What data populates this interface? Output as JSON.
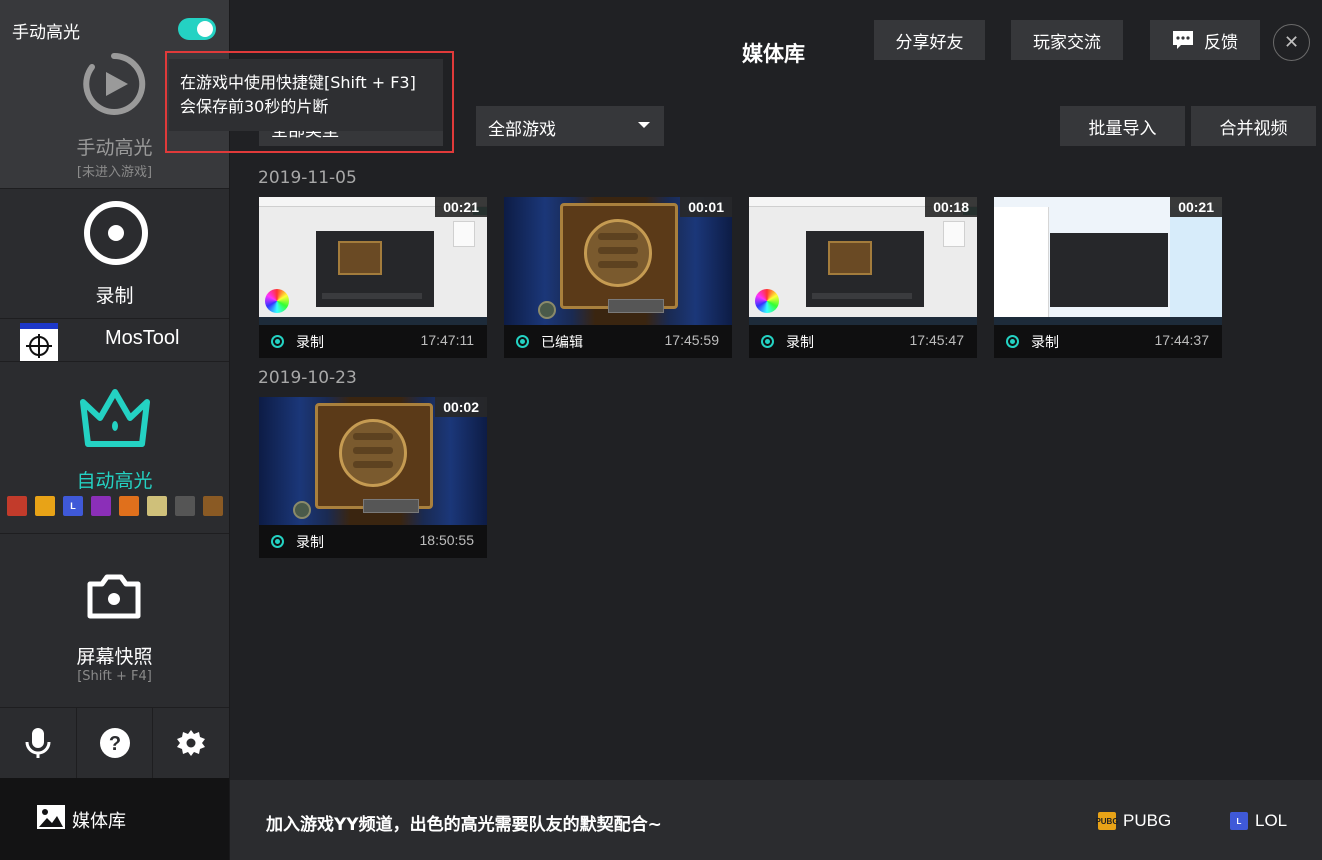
{
  "sidebar": {
    "manual_toggle_label": "手动高光",
    "manual_toggle_on": true,
    "manual_title": "手动高光",
    "manual_sub": "[未进入游戏]",
    "record_label": "录制",
    "mostool_label": "MosTool",
    "auto_label": "自动高光",
    "auto_games": [
      {
        "name": "dota2-icon",
        "text": "",
        "color": "#c23b2b"
      },
      {
        "name": "pubg-icon",
        "text": "PUBG",
        "color": "#e8a317"
      },
      {
        "name": "lol-icon",
        "text": "L",
        "color": "#3f59d8"
      },
      {
        "name": "csgo-icon",
        "text": "",
        "color": "#8b2fb8"
      },
      {
        "name": "crossfire-icon",
        "text": "",
        "color": "#e0701c"
      },
      {
        "name": "pubg-mobile-icon",
        "text": "",
        "color": "#cfc07a"
      },
      {
        "name": "overwatch-icon",
        "text": "",
        "color": "#555555"
      },
      {
        "name": "hearthstone-icon",
        "text": "",
        "color": "#8a5a24"
      }
    ],
    "snapshot_label": "屏幕快照",
    "snapshot_sub": "[Shift + F4]",
    "tools": [
      "microphone-icon",
      "help-icon",
      "settings-icon"
    ],
    "media_label": "媒体库"
  },
  "header": {
    "title": "媒体库",
    "share_label": "分享好友",
    "community_label": "玩家交流",
    "feedback_label": "反馈"
  },
  "toolbar": {
    "type_filter_label": "全部类型",
    "game_filter_label": "全部游戏",
    "import_label": "批量导入",
    "merge_label": "合并视频"
  },
  "tooltip": {
    "line1": "在游戏中使用快捷键[Shift + F3]",
    "line2": "会保存前30秒的片断"
  },
  "groups": [
    {
      "date": "2019-11-05",
      "clips": [
        {
          "duration": "00:21",
          "tag": "录制",
          "time": "17:47:11",
          "thumb": "screen"
        },
        {
          "duration": "00:01",
          "tag": "已编辑",
          "time": "17:45:59",
          "thumb": "game"
        },
        {
          "duration": "00:18",
          "tag": "录制",
          "time": "17:45:47",
          "thumb": "screen"
        },
        {
          "duration": "00:21",
          "tag": "录制",
          "time": "17:44:37",
          "thumb": "screen2"
        }
      ]
    },
    {
      "date": "2019-10-23",
      "clips": [
        {
          "duration": "00:02",
          "tag": "录制",
          "time": "18:50:55",
          "thumb": "game"
        }
      ]
    }
  ],
  "bottom": {
    "message": "加入游戏YY频道，出色的高光需要队友的默契配合~",
    "games": [
      {
        "label": "PUBG",
        "badge": "PUBG",
        "color": "#e8a317"
      },
      {
        "label": "LOL",
        "badge": "L",
        "color": "#3f59d8"
      }
    ]
  },
  "colors": {
    "accent": "#24d2c3",
    "highlight_border": "#e03a3a"
  }
}
